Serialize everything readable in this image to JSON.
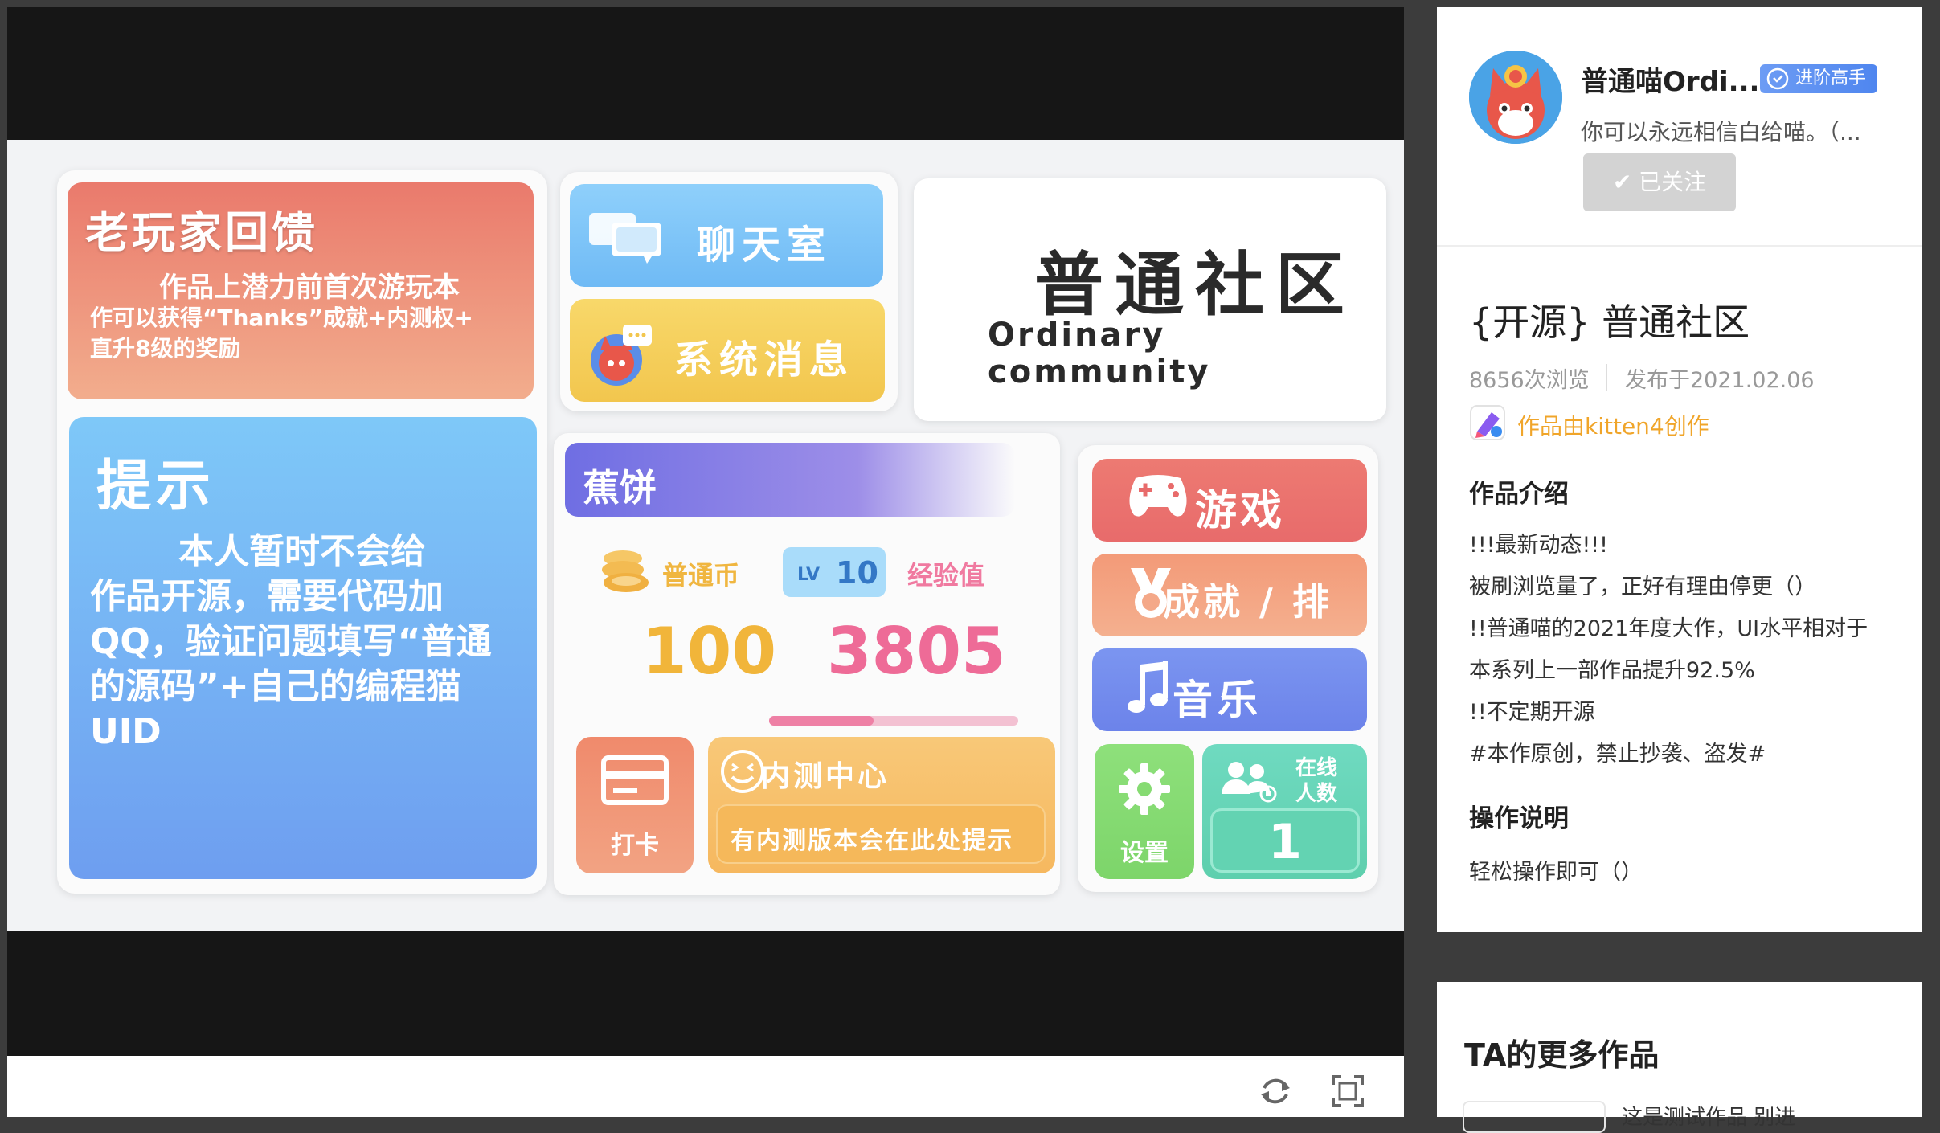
{
  "game": {
    "veteran": {
      "title": "老玩家回馈",
      "line1": "作品上潜力前首次游玩本",
      "line2": "作可以获得“Thanks”成就+内测权+",
      "line3": "直升8级的奖励"
    },
    "tip": {
      "title": "提示",
      "line1": "本人暂时不会给",
      "line2": "作品开源，需要代码加",
      "line3": "QQ，验证问题填写“普通",
      "line4": "的源码”+自己的编程猫",
      "line5": "UID"
    },
    "chat_label": "聊天室",
    "sysmsg_label": "系统消息",
    "title_cn": "普通社区",
    "title_en": "Ordinary community",
    "banana": {
      "title": "蕉饼",
      "coin_label": "普通币",
      "level_prefix": "LV",
      "level": "10",
      "exp_label": "经验值",
      "coin_value": "100",
      "exp_value": "3805",
      "exp_progress": 0.42
    },
    "checkin_label": "打卡",
    "beta": {
      "title": "内测中心",
      "note": "有内测版本会在此处提示"
    },
    "menu": {
      "game_label": "游戏",
      "rank_label": "成就 / 排行",
      "music_label": "音乐",
      "settings_label": "设置",
      "online_label": "在线人数",
      "online_count": "1"
    }
  },
  "sidebar": {
    "author": {
      "name": "普通喵Ordi...",
      "badge": "进阶高手",
      "bio": "你可以永远相信白给喵。（...",
      "follow_label": "✔ 已关注"
    },
    "work": {
      "title": "{开源} 普通社区",
      "views": "8656次浏览",
      "published": "发布于2021.02.06",
      "creator": "作品由kitten4创作"
    },
    "intro": {
      "heading": "作品介绍",
      "lines": [
        "!!!最新动态!!!",
        "被刷浏览量了，正好有理由停更（）",
        "!!普通喵的2021年度大作，UI水平相对于",
        "本系列上一部作品提升92.5%",
        "!!不定期开源",
        "#本作原创，禁止抄袭、盗发#"
      ]
    },
    "ops": {
      "heading": "操作说明",
      "text": "轻松操作即可（）"
    },
    "more": {
      "heading": "TA的更多作品",
      "first_item": "这是测试作品 别进"
    }
  },
  "colors": {
    "brand_orange": "#f0a52a",
    "badge_blue": "#5b8ff0",
    "follow_gray": "#d3d3d3"
  }
}
